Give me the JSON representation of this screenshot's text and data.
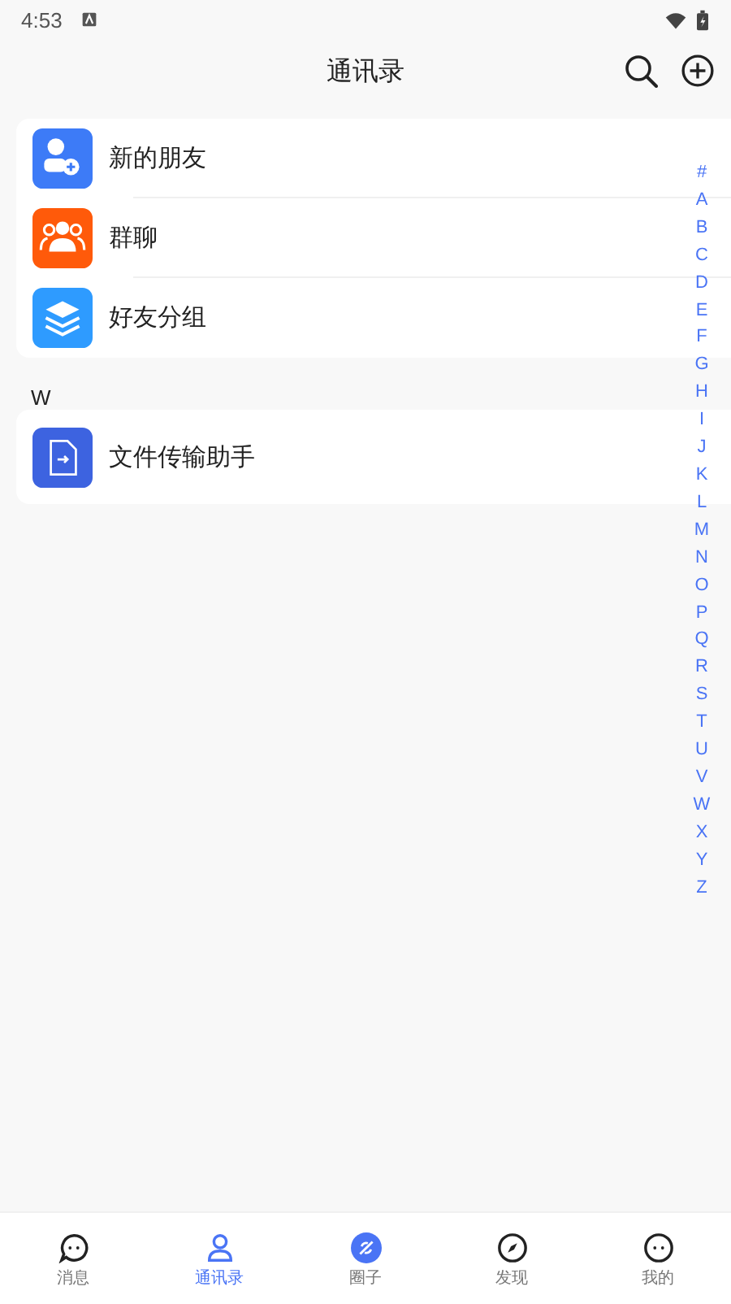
{
  "status_bar": {
    "time": "4:53"
  },
  "header": {
    "title": "通讯录"
  },
  "top_entries": [
    {
      "kind": "new-friend",
      "label": "新的朋友",
      "color": "#3d7bf7"
    },
    {
      "kind": "group-chat",
      "label": "群聊",
      "color": "#ff5a0a"
    },
    {
      "kind": "friend-groups",
      "label": "好友分组",
      "color": "#2e9bff"
    }
  ],
  "sections": [
    {
      "letter": "W",
      "contacts": [
        {
          "kind": "file-transfer",
          "label": "文件传输助手",
          "color": "#3d63e0"
        }
      ]
    }
  ],
  "index_letters": [
    "#",
    "A",
    "B",
    "C",
    "D",
    "E",
    "F",
    "G",
    "H",
    "I",
    "J",
    "K",
    "L",
    "M",
    "N",
    "O",
    "P",
    "Q",
    "R",
    "S",
    "T",
    "U",
    "V",
    "W",
    "X",
    "Y",
    "Z"
  ],
  "tabs": [
    {
      "kind": "chat",
      "label": "消息",
      "selected": false
    },
    {
      "kind": "contacts",
      "label": "通讯录",
      "selected": true
    },
    {
      "kind": "circle",
      "label": "圈子",
      "selected": false
    },
    {
      "kind": "discover",
      "label": "发现",
      "selected": false
    },
    {
      "kind": "me",
      "label": "我的",
      "selected": false
    }
  ]
}
